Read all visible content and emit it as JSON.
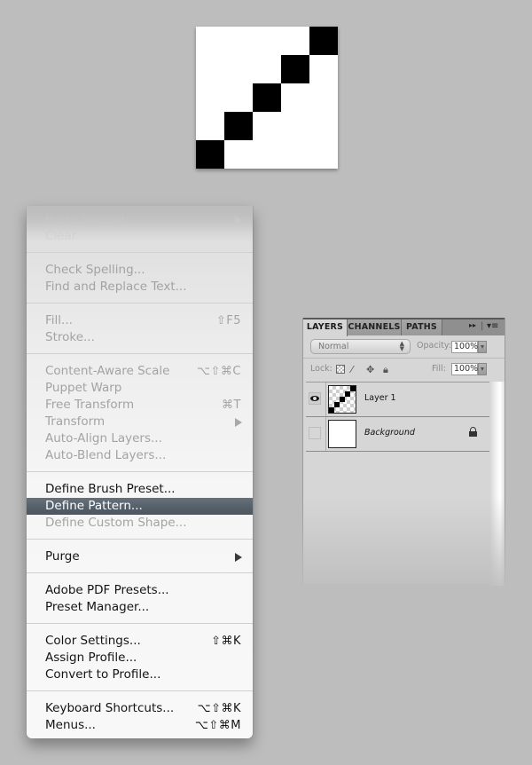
{
  "canvas": {
    "background": "#ffffff",
    "block_color": "#000000",
    "blocks": [
      {
        "col": 0,
        "row": 4
      },
      {
        "col": 1,
        "row": 3
      },
      {
        "col": 2,
        "row": 2
      },
      {
        "col": 3,
        "row": 1
      },
      {
        "col": 4,
        "row": 0
      }
    ]
  },
  "edit_menu": {
    "highlight_color": "#56616c",
    "items": [
      {
        "label": "Paste Special",
        "shortcut": "",
        "submenu": true,
        "state": "faded"
      },
      {
        "label": "Clear",
        "shortcut": "",
        "submenu": false,
        "state": "faded"
      },
      {
        "label": "Check Spelling...",
        "shortcut": "",
        "submenu": false,
        "state": "disabled"
      },
      {
        "label": "Find and Replace Text...",
        "shortcut": "",
        "submenu": false,
        "state": "disabled"
      },
      {
        "label": "Fill...",
        "shortcut": "⇧F5",
        "submenu": false,
        "state": "disabled"
      },
      {
        "label": "Stroke...",
        "shortcut": "",
        "submenu": false,
        "state": "disabled"
      },
      {
        "label": "Content-Aware Scale",
        "shortcut": "⌥⇧⌘C",
        "submenu": false,
        "state": "disabled"
      },
      {
        "label": "Puppet Warp",
        "shortcut": "",
        "submenu": false,
        "state": "disabled"
      },
      {
        "label": "Free Transform",
        "shortcut": "⌘T",
        "submenu": false,
        "state": "disabled"
      },
      {
        "label": "Transform",
        "shortcut": "",
        "submenu": true,
        "state": "disabled"
      },
      {
        "label": "Auto-Align Layers...",
        "shortcut": "",
        "submenu": false,
        "state": "disabled"
      },
      {
        "label": "Auto-Blend Layers...",
        "shortcut": "",
        "submenu": false,
        "state": "disabled"
      },
      {
        "label": "Define Brush Preset...",
        "shortcut": "",
        "submenu": false,
        "state": "enabled"
      },
      {
        "label": "Define Pattern...",
        "shortcut": "",
        "submenu": false,
        "state": "selected"
      },
      {
        "label": "Define Custom Shape...",
        "shortcut": "",
        "submenu": false,
        "state": "disabled"
      },
      {
        "label": "Purge",
        "shortcut": "",
        "submenu": true,
        "state": "enabled"
      },
      {
        "label": "Adobe PDF Presets...",
        "shortcut": "",
        "submenu": false,
        "state": "enabled"
      },
      {
        "label": "Preset Manager...",
        "shortcut": "",
        "submenu": false,
        "state": "enabled"
      },
      {
        "label": "Color Settings...",
        "shortcut": "⇧⌘K",
        "submenu": false,
        "state": "enabled"
      },
      {
        "label": "Assign Profile...",
        "shortcut": "",
        "submenu": false,
        "state": "enabled"
      },
      {
        "label": "Convert to Profile...",
        "shortcut": "",
        "submenu": false,
        "state": "enabled"
      },
      {
        "label": "Keyboard Shortcuts...",
        "shortcut": "⌥⇧⌘K",
        "submenu": false,
        "state": "enabled"
      },
      {
        "label": "Menus...",
        "shortcut": "⌥⇧⌘M",
        "submenu": false,
        "state": "enabled"
      }
    ]
  },
  "layers_panel": {
    "tabs": [
      {
        "label": "LAYERS",
        "active": true
      },
      {
        "label": "CHANNELS",
        "active": false
      },
      {
        "label": "PATHS",
        "active": false
      }
    ],
    "collapse_icon": "▸▸",
    "menu_icon": "▾≡",
    "blend_mode": "Normal",
    "opacity_label": "Opacity:",
    "opacity_value": "100%",
    "lock_label": "Lock:",
    "fill_label": "Fill:",
    "fill_value": "100%",
    "lock_icons": [
      "lock-transparent-icon",
      "lock-image-icon",
      "lock-position-icon",
      "lock-all-icon"
    ],
    "layers": [
      {
        "name": "Layer 1",
        "visible": true,
        "italic": false,
        "locked": false,
        "thumbnail": "transparent-diagonal"
      },
      {
        "name": "Background",
        "visible": false,
        "italic": true,
        "locked": true,
        "thumbnail": "white"
      }
    ]
  }
}
